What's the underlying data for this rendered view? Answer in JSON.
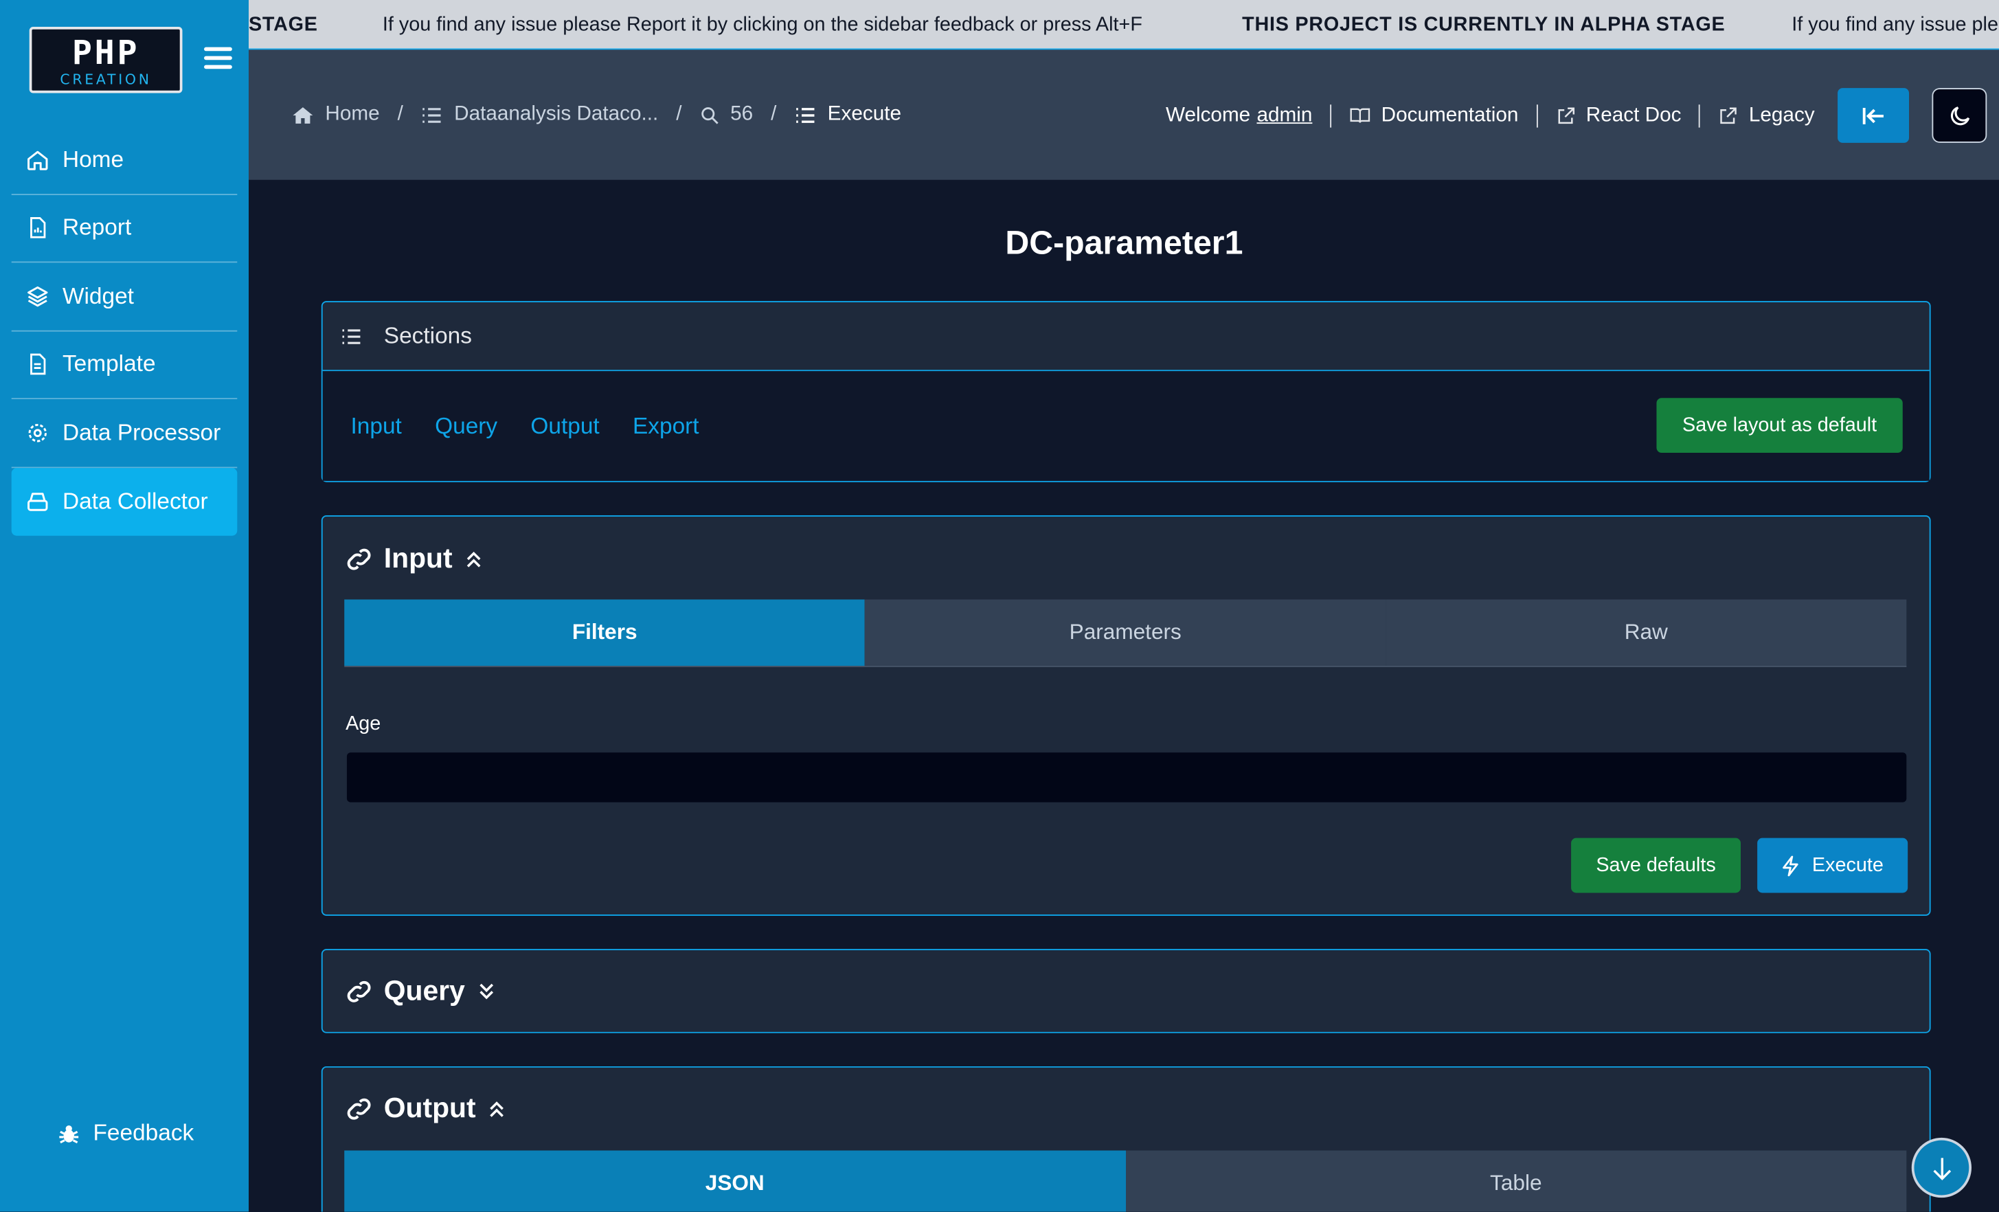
{
  "sidebar": {
    "logo_top": "PHP",
    "logo_bottom": "CREATION",
    "items": [
      {
        "label": "Home",
        "icon": "home-icon"
      },
      {
        "label": "Report",
        "icon": "report-icon"
      },
      {
        "label": "Widget",
        "icon": "layers-icon"
      },
      {
        "label": "Template",
        "icon": "file-icon"
      },
      {
        "label": "Data Processor",
        "icon": "gear-icon"
      },
      {
        "label": "Data Collector",
        "icon": "database-icon",
        "active": true
      }
    ],
    "feedback": "Feedback"
  },
  "ticker": {
    "stage_fragment": "STAGE",
    "message": "If you find any issue please Report it by clicking on the sidebar feedback or press Alt+F",
    "alpha": "THIS PROJECT IS CURRENTLY IN ALPHA STAGE",
    "message_fragment": "If you find any issue ple"
  },
  "breadcrumb": {
    "home": "Home",
    "collector": "Dataanalysis Dataco...",
    "id": "56",
    "current": "Execute"
  },
  "header": {
    "welcome": "Welcome",
    "user": "admin",
    "documentation": "Documentation",
    "react_doc": "React Doc",
    "legacy": "Legacy"
  },
  "page_title": "DC-parameter1",
  "sections": {
    "title": "Sections",
    "links": [
      "Input",
      "Query",
      "Output",
      "Export"
    ],
    "save_layout": "Save layout as default"
  },
  "input_card": {
    "title": "Input",
    "tabs": [
      "Filters",
      "Parameters",
      "Raw"
    ],
    "active_tab": "Filters",
    "field_label": "Age",
    "field_value": "",
    "save_defaults": "Save defaults",
    "execute": "Execute"
  },
  "query_card": {
    "title": "Query"
  },
  "output_card": {
    "title": "Output",
    "tabs": [
      "JSON",
      "Table"
    ],
    "active_tab": "JSON"
  },
  "colors": {
    "sidebar": "#0a8bc6",
    "accent": "#0ea5e9",
    "success": "#15803d",
    "background": "#0f172a",
    "panel": "#1e293b"
  }
}
